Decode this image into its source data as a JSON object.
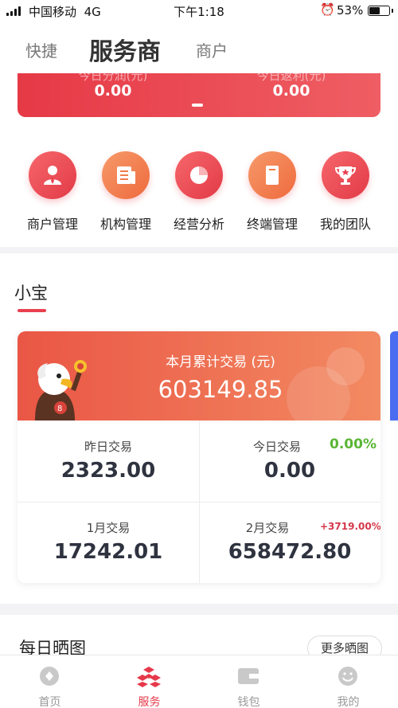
{
  "status_bar": {
    "carrier": "中国移动",
    "network": "4G",
    "time": "下午1:18",
    "battery": "53%",
    "battery_level": 0.53
  },
  "top_tabs": [
    {
      "label": "快捷",
      "active": false
    },
    {
      "label": "服务商",
      "active": true
    },
    {
      "label": "商户",
      "active": false
    }
  ],
  "summary": {
    "left_label": "今日分润(元)",
    "left_value": "0.00",
    "right_label": "今日返利(元)",
    "right_value": "0.00"
  },
  "quick_menu": [
    {
      "label": "商户管理",
      "icon": "person-icon",
      "color": "red"
    },
    {
      "label": "机构管理",
      "icon": "document-icon",
      "color": "orange"
    },
    {
      "label": "经营分析",
      "icon": "pie-chart-icon",
      "color": "red"
    },
    {
      "label": "终端管理",
      "icon": "terminal-icon",
      "color": "orange"
    },
    {
      "label": "我的团队",
      "icon": "trophy-icon",
      "color": "red"
    }
  ],
  "section": {
    "title": "小宝"
  },
  "card": {
    "monthly_label": "本月累计交易 (元)",
    "monthly_value": "603149.85",
    "yesterday_label": "昨日交易",
    "yesterday_value": "2323.00",
    "today_label": "今日交易",
    "today_pct": "0.00%",
    "today_value": "0.00",
    "jan_label": "1月交易",
    "jan_value": "17242.01",
    "feb_label": "2月交易",
    "feb_pct": "+3719.00%",
    "feb_value": "658472.80",
    "colors": {
      "green": "#5ab534",
      "red": "#d4384a"
    }
  },
  "daily": {
    "title": "每日晒图",
    "more_label": "更多晒图"
  },
  "bottom_nav": [
    {
      "label": "首页",
      "icon": "home-icon",
      "active": false
    },
    {
      "label": "服务",
      "icon": "service-icon",
      "active": true
    },
    {
      "label": "钱包",
      "icon": "wallet-icon",
      "active": false
    },
    {
      "label": "我的",
      "icon": "profile-icon",
      "active": false
    }
  ],
  "accent_color": "#e6394a"
}
